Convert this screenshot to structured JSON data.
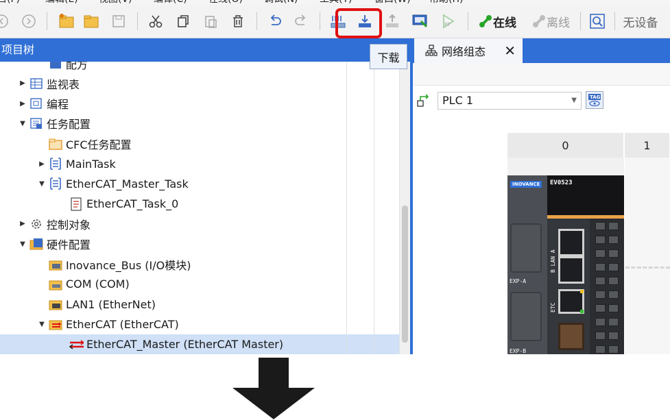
{
  "menu": [
    "目(F)",
    "编辑(E)",
    "视图(V)",
    "编译(C)",
    "在线(O)",
    "调试(N)",
    "工具(T)",
    "窗口(W)",
    "帮助(H)"
  ],
  "toolbar": {
    "online_label": "在线",
    "offline_label": "离线",
    "device_label": "无设备",
    "download_tooltip": "下载"
  },
  "left_panel": {
    "title": "项目树",
    "items": [
      {
        "label": "配方",
        "level": 2,
        "arrow": "",
        "icon": "recipe-icon"
      },
      {
        "label": "监视表",
        "level": 1,
        "arrow": "▶",
        "icon": "watch-table-icon"
      },
      {
        "label": "编程",
        "level": 1,
        "arrow": "▶",
        "icon": "program-icon"
      },
      {
        "label": "任务配置",
        "level": 1,
        "arrow": "▼",
        "icon": "task-config-icon"
      },
      {
        "label": "CFC任务配置",
        "level": 2,
        "arrow": "",
        "icon": "folder-icon"
      },
      {
        "label": "MainTask",
        "level": 2,
        "arrow": "▶",
        "icon": "task-icon"
      },
      {
        "label": "EtherCAT_Master_Task",
        "level": 2,
        "arrow": "▼",
        "icon": "task-icon"
      },
      {
        "label": "EtherCAT_Task_0",
        "level": 3,
        "arrow": "",
        "icon": "document-icon"
      },
      {
        "label": "控制对象",
        "level": 1,
        "arrow": "▶",
        "icon": "gear-icon"
      },
      {
        "label": "硬件配置",
        "level": 1,
        "arrow": "▼",
        "icon": "hardware-folder-icon"
      },
      {
        "label": "Inovance_Bus (I/O模块)",
        "level": 2,
        "arrow": "",
        "icon": "bus-icon"
      },
      {
        "label": "COM (COM)",
        "level": 2,
        "arrow": "",
        "icon": "com-icon"
      },
      {
        "label": "LAN1 (EtherNet)",
        "level": 2,
        "arrow": "",
        "icon": "lan-icon"
      },
      {
        "label": "EtherCAT (EtherCAT)",
        "level": 2,
        "arrow": "▼",
        "icon": "ethercat-icon"
      },
      {
        "label": "EtherCAT_Master (EtherCAT Master)",
        "level": 3,
        "arrow": "",
        "icon": "ethercat-master-icon",
        "selected": true
      }
    ]
  },
  "right_panel": {
    "tab_label": "网络组态",
    "plc_select": "PLC 1",
    "slots": [
      "0",
      "1"
    ],
    "device": {
      "brand": "INOVANCE",
      "model": "EV0523",
      "exp_a": "EXP-A",
      "exp_b": "EXP-B",
      "lan_label": "B LAN A",
      "etc_label": "ETC"
    }
  },
  "colors": {
    "accent": "#2f6fd6",
    "highlight": "#e01010",
    "selected_row": "#cfe0f7",
    "online": "#2aa52a"
  }
}
